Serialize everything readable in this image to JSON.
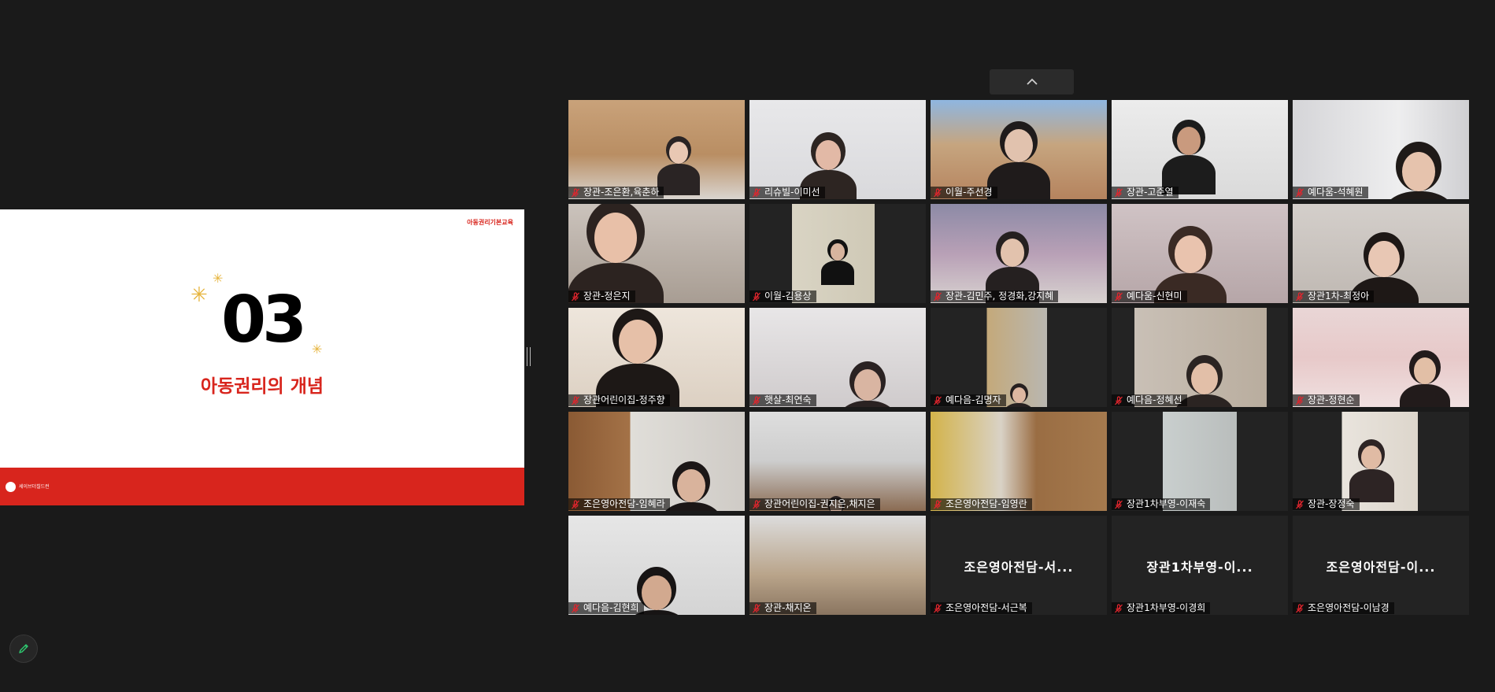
{
  "slide": {
    "header": "아동권리기본교육",
    "number": "03",
    "title": "아동권리의 개념",
    "footer_logo": "세이브더칠드런"
  },
  "gallery": {
    "participants": [
      {
        "name": "장관-조은환,육춘하",
        "video": true
      },
      {
        "name": "리슈빌-이미선",
        "video": true
      },
      {
        "name": "이월-주선경",
        "video": true
      },
      {
        "name": "장관-고준열",
        "video": true
      },
      {
        "name": "예다움-석혜원",
        "video": true
      },
      {
        "name": "장관-정은지",
        "video": true
      },
      {
        "name": "이월-김용상",
        "video": true
      },
      {
        "name": "장관-김민주, 정경화,강지혜",
        "video": true
      },
      {
        "name": "예다움-신현미",
        "video": true
      },
      {
        "name": "장관1차-최정아",
        "video": true
      },
      {
        "name": "장관어린이집-정주향",
        "video": true
      },
      {
        "name": "햇살-최연숙",
        "video": true
      },
      {
        "name": "예다음-김명자",
        "video": true
      },
      {
        "name": "예다음-정혜선",
        "video": true
      },
      {
        "name": "장관-정현순",
        "video": true
      },
      {
        "name": "조은영아전담-임혜라",
        "video": true
      },
      {
        "name": "장관어린이집-권지은,채지은",
        "video": true
      },
      {
        "name": "조은영아전담-임영란",
        "video": true
      },
      {
        "name": "장관1차부영-이재숙",
        "video": true
      },
      {
        "name": "장관-장정숙",
        "video": true
      },
      {
        "name": "예다음-김현희",
        "video": true
      },
      {
        "name": "장관-채지온",
        "video": true
      },
      {
        "name": "조은영아전담-서근복",
        "video": false,
        "display": "조은영아전담-서..."
      },
      {
        "name": "장관1차부영-이경희",
        "video": false,
        "display": "장관1차부영-이..."
      },
      {
        "name": "조은영아전담-이남경",
        "video": false,
        "display": "조은영아전담-이..."
      }
    ]
  },
  "icons": {
    "collapse": "chevron-up-icon",
    "mic": "mic-off-icon",
    "annotate": "pencil-icon"
  },
  "colors": {
    "background": "#1a1a1a",
    "accent_red": "#d8251d",
    "mic_muted": "#e0252d",
    "annotate_green": "#2ecc71"
  }
}
